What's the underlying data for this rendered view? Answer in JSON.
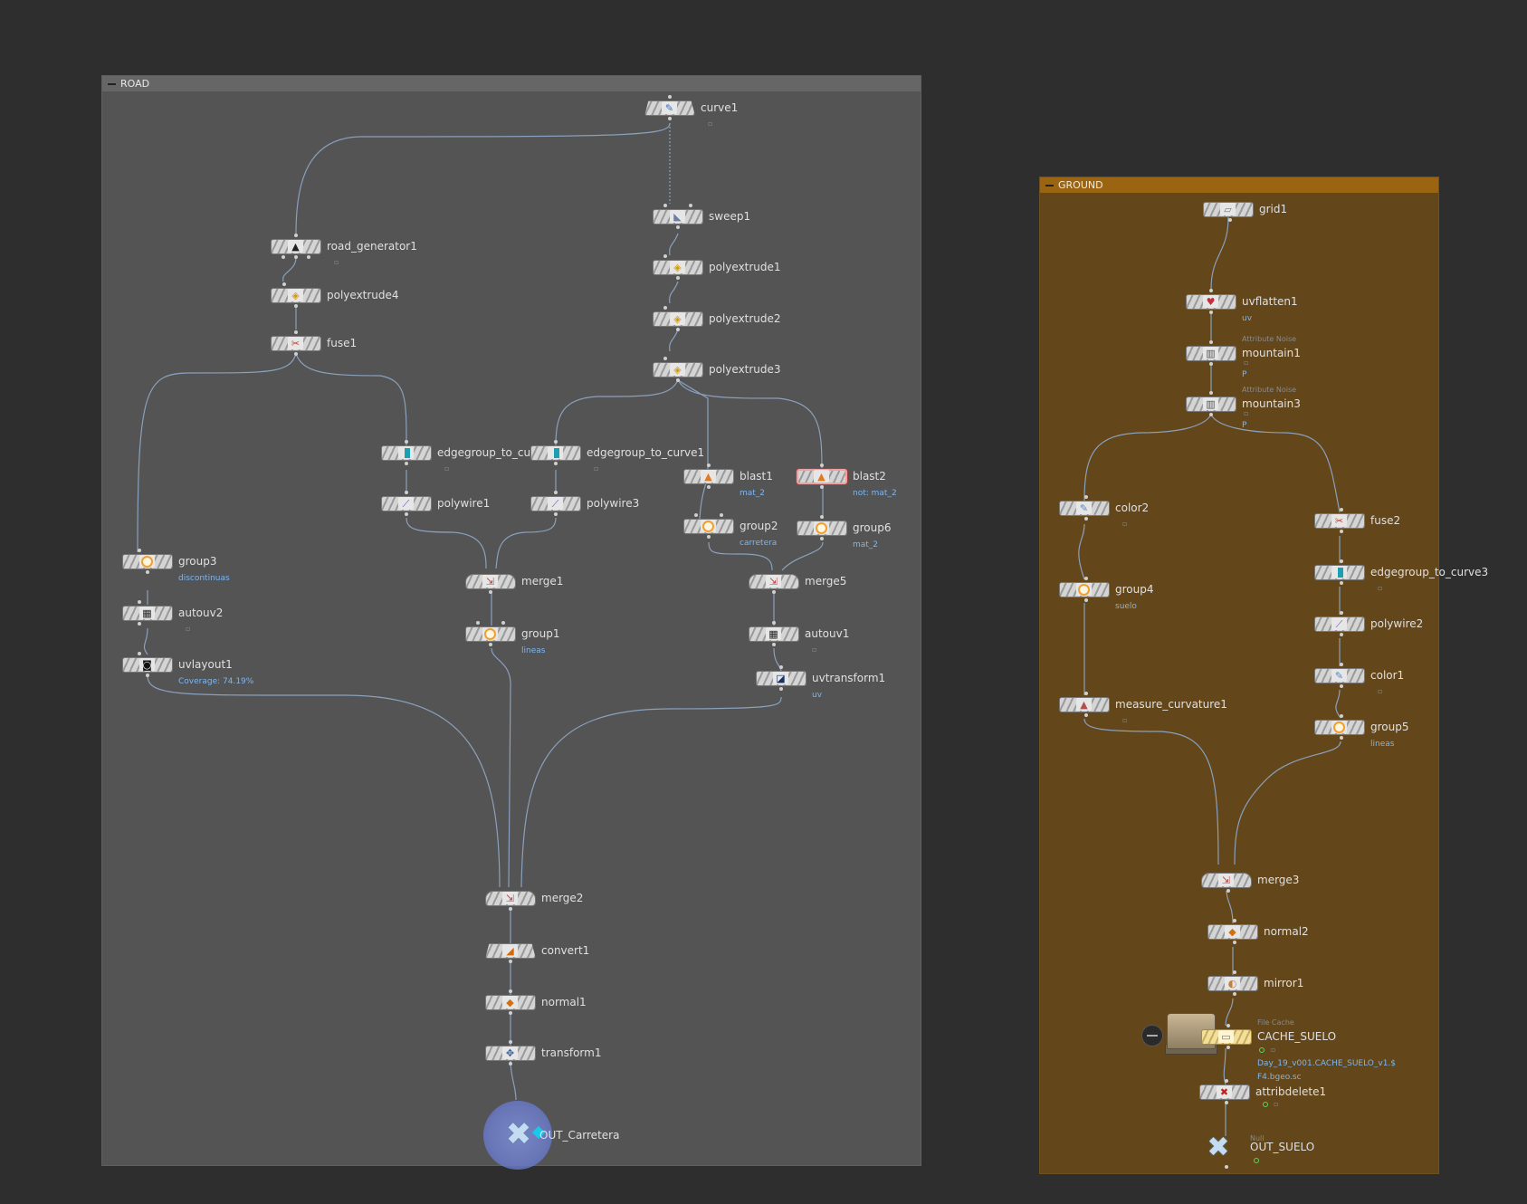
{
  "networks": {
    "road": {
      "title": "ROAD",
      "nodes": {
        "curve1": {
          "label": "curve1",
          "icon": "curve-icon"
        },
        "road_generator1": {
          "label": "road_generator1",
          "icon": "road-icon"
        },
        "polyextrude4": {
          "label": "polyextrude4",
          "icon": "polyextrude-icon"
        },
        "fuse1": {
          "label": "fuse1",
          "icon": "fuse-icon"
        },
        "sweep1": {
          "label": "sweep1",
          "icon": "sweep-icon"
        },
        "polyextrude1": {
          "label": "polyextrude1",
          "icon": "polyextrude-icon"
        },
        "polyextrude2": {
          "label": "polyextrude2",
          "icon": "polyextrude-icon"
        },
        "polyextrude3": {
          "label": "polyextrude3",
          "icon": "polyextrude-icon"
        },
        "edgegroup_to_curve_a": {
          "label": "edgegroup_to_cur",
          "icon": "edgegroup-icon"
        },
        "edgegroup_to_curve1": {
          "label": "edgegroup_to_curve1",
          "icon": "edgegroup-icon"
        },
        "blast1": {
          "label": "blast1",
          "sub": "mat_2",
          "icon": "blast-icon"
        },
        "blast2": {
          "label": "blast2",
          "sub": "not: mat_2",
          "icon": "blast-icon"
        },
        "polywire1": {
          "label": "polywire1",
          "icon": "polywire-icon"
        },
        "polywire3": {
          "label": "polywire3",
          "icon": "polywire-icon"
        },
        "group2": {
          "label": "group2",
          "sub": "carretera",
          "icon": "group-icon"
        },
        "group6": {
          "label": "group6",
          "sub": "mat_2",
          "icon": "group-icon"
        },
        "group3": {
          "label": "group3",
          "sub": "discontinuas",
          "icon": "group-icon"
        },
        "merge1": {
          "label": "merge1",
          "icon": "merge-icon"
        },
        "merge5": {
          "label": "merge5",
          "icon": "merge-icon"
        },
        "autouv2": {
          "label": "autouv2",
          "icon": "autouv-icon"
        },
        "group1": {
          "label": "group1",
          "sub": "lineas",
          "icon": "group-icon"
        },
        "autouv1": {
          "label": "autouv1",
          "icon": "autouv-icon"
        },
        "uvlayout1": {
          "label": "uvlayout1",
          "sub": "Coverage: 74.19%",
          "icon": "uvlayout-icon"
        },
        "uvtransform1": {
          "label": "uvtransform1",
          "sub": "uv",
          "icon": "uvtransform-icon"
        },
        "merge2": {
          "label": "merge2",
          "icon": "merge-icon"
        },
        "convert1": {
          "label": "convert1",
          "icon": "convert-icon"
        },
        "normal1": {
          "label": "normal1",
          "icon": "normal-icon"
        },
        "transform1": {
          "label": "transform1",
          "icon": "transform-icon"
        },
        "OUT_Carretera": {
          "label": "OUT_Carretera",
          "icon": "null-output-icon"
        }
      }
    },
    "ground": {
      "title": "GROUND",
      "nodes": {
        "grid1": {
          "label": "grid1",
          "icon": "grid-icon"
        },
        "uvflatten1": {
          "label": "uvflatten1",
          "sub": "uv",
          "icon": "uvflatten-icon"
        },
        "mountain1": {
          "label": "mountain1",
          "above": "Attribute Noise",
          "sub": "P",
          "icon": "mountain-icon"
        },
        "mountain3": {
          "label": "mountain3",
          "above": "Attribute Noise",
          "sub": "P",
          "icon": "mountain-icon"
        },
        "color2": {
          "label": "color2",
          "icon": "color-icon"
        },
        "group4": {
          "label": "group4",
          "sub": "suelo",
          "icon": "group-icon"
        },
        "measure_curvature1": {
          "label": "measure_curvature1",
          "icon": "measure-icon"
        },
        "fuse2": {
          "label": "fuse2",
          "icon": "fuse-icon"
        },
        "edgegroup_to_curve3": {
          "label": "edgegroup_to_curve3",
          "icon": "edgegroup-icon"
        },
        "polywire2": {
          "label": "polywire2",
          "icon": "polywire-icon"
        },
        "color1": {
          "label": "color1",
          "icon": "color-icon"
        },
        "group5": {
          "label": "group5",
          "sub": "lineas",
          "icon": "group-icon"
        },
        "merge3": {
          "label": "merge3",
          "icon": "merge-icon"
        },
        "normal2": {
          "label": "normal2",
          "icon": "normal-icon"
        },
        "mirror1": {
          "label": "mirror1",
          "icon": "mirror-icon"
        },
        "CACHE_SUELO": {
          "label": "CACHE_SUELO",
          "above": "File Cache",
          "sub": "Day_19_v001.CACHE_SUELO_v1.$",
          "sub2": "F4.bgeo.sc",
          "icon": "file-cache-icon"
        },
        "attribdelete1": {
          "label": "attribdelete1",
          "icon": "attribdelete-icon"
        },
        "OUT_SUELO": {
          "label": "OUT_SUELO",
          "above": "Null",
          "icon": "null-icon"
        }
      }
    }
  },
  "colors": {
    "background": "#2e2e2e",
    "road_box": "#545454",
    "ground_box": "#634619",
    "ground_header": "#9a6410",
    "wire": "#8aa0bc",
    "label_blue": "#7db6f0"
  }
}
